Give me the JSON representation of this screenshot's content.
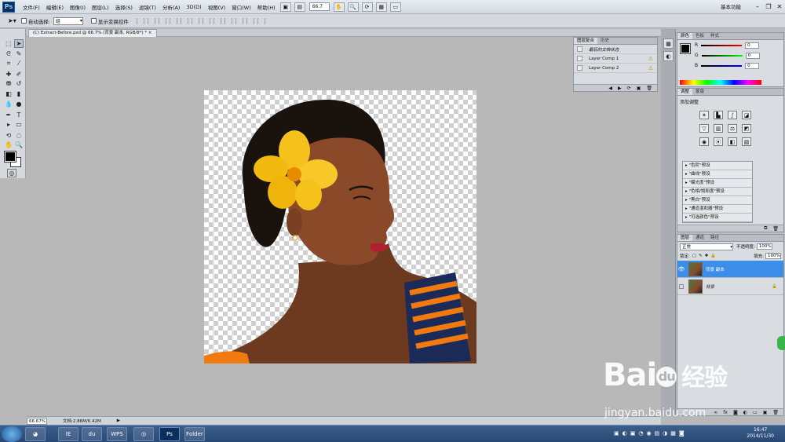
{
  "app": {
    "logo": "Ps"
  },
  "menu": [
    "文件(F)",
    "编辑(E)",
    "图像(I)",
    "图层(L)",
    "选择(S)",
    "滤镜(T)",
    "分析(A)",
    "3D(D)",
    "视图(V)",
    "窗口(W)",
    "帮助(H)"
  ],
  "toolbar": {
    "zoom": "66.7",
    "workspace": "基本功能"
  },
  "options": {
    "auto_select_label": "自动选择:",
    "auto_select_value": "组",
    "show_transform_label": "显示变换控件"
  },
  "document": {
    "tab_title": "(C) Extract-Before.psd @ 66.7% (背景 副本, RGB/8*) *",
    "close": "×"
  },
  "status": {
    "zoom": "66.67%",
    "doc_info": "文档:2.86M/6.42M"
  },
  "layer_comps": {
    "tabs": [
      "图层复合",
      "历史"
    ],
    "rows": [
      {
        "name": "最后的文档状态",
        "warning": false
      },
      {
        "name": "Layer Comp 1",
        "warning": true
      },
      {
        "name": "Layer Comp 2",
        "warning": true
      }
    ]
  },
  "color_panel": {
    "tabs": [
      "颜色",
      "色板",
      "样式"
    ],
    "channels": [
      {
        "label": "R",
        "value": "0",
        "color": "#d02020"
      },
      {
        "label": "G",
        "value": "0",
        "color": "#20a020"
      },
      {
        "label": "B",
        "value": "0",
        "color": "#2020d0"
      }
    ]
  },
  "adjustments": {
    "tabs": [
      "调整",
      "蒙版"
    ],
    "heading": "添加调整",
    "presets": [
      "\"色阶\"预设",
      "\"曲线\"预设",
      "\"曝光度\"预设",
      "\"色相/饱和度\"预设",
      "\"黑白\"预设",
      "\"通道混和器\"预设",
      "\"可选颜色\"预设"
    ]
  },
  "layers_panel": {
    "tabs": [
      "图层",
      "通道",
      "路径"
    ],
    "blend_mode": "正常",
    "opacity_label": "不透明度:",
    "opacity": "100%",
    "lock_label": "锁定:",
    "fill_label": "填充:",
    "fill": "100%",
    "layers": [
      {
        "name": "背景 副本",
        "selected": true,
        "visible": true
      },
      {
        "name": "背景",
        "selected": false,
        "visible": false
      }
    ]
  },
  "taskbar": {
    "time": "16:47",
    "date": "2014/11/30",
    "apps": [
      "IE",
      "du",
      "WPS",
      "Ps",
      "Folder"
    ]
  },
  "watermark": {
    "brand": "Bai",
    "brand2": "du",
    "cn": "经验",
    "url": "jingyan.baidu.com"
  },
  "colors": {
    "accent": "#3d8ee8",
    "flower": "#f5c21b",
    "skin": "#8a4a2a"
  }
}
